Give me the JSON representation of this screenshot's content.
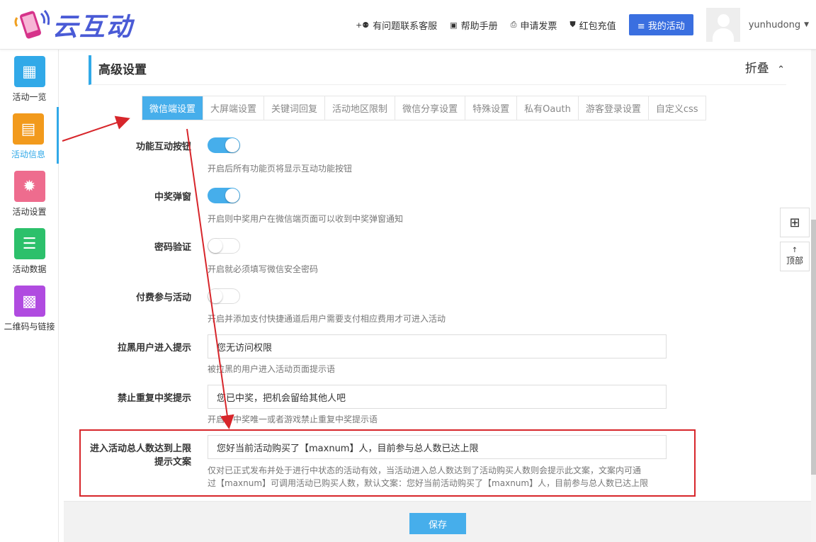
{
  "app": {
    "logo_text": "云互动"
  },
  "header": {
    "links": [
      {
        "icon": "user-plus-icon",
        "label": "有问题联系客服"
      },
      {
        "icon": "book-icon",
        "label": "帮助手册"
      },
      {
        "icon": "printer-icon",
        "label": "申请发票"
      },
      {
        "icon": "shield-icon",
        "label": "红包充值"
      }
    ],
    "my_activity": "≡ 我的活动",
    "username": "yunhudong"
  },
  "sidebar": {
    "items": [
      {
        "label": "活动一览",
        "icon": "grid-icon",
        "color": "#31a9e8"
      },
      {
        "label": "活动信息",
        "icon": "document-icon",
        "color": "#f29a1c"
      },
      {
        "label": "活动设置",
        "icon": "gear-icon",
        "color": "#ee6c8e"
      },
      {
        "label": "活动数据",
        "icon": "database-icon",
        "color": "#2cc06b"
      },
      {
        "label": "二维码与链接",
        "icon": "qrcode-icon",
        "color": "#b04be0"
      }
    ]
  },
  "section": {
    "title": "高级设置",
    "collapse_label": "折叠"
  },
  "tabs": [
    "微信端设置",
    "大屏端设置",
    "关键词回复",
    "活动地区限制",
    "微信分享设置",
    "特殊设置",
    "私有Oauth",
    "游客登录设置",
    "自定义css"
  ],
  "settings": {
    "func_button": {
      "label": "功能互动按钮",
      "enabled": true,
      "help": "开启后所有功能页将显示互动功能按钮"
    },
    "prize_popup": {
      "label": "中奖弹窗",
      "enabled": true,
      "help": "开启则中奖用户在微信端页面可以收到中奖弹窗通知"
    },
    "password": {
      "label": "密码验证",
      "enabled": false,
      "help": "开启就必须填写微信安全密码"
    },
    "paid": {
      "label": "付费参与活动",
      "enabled": false,
      "help": "开启并添加支付快捷通道后用户需要支付相应费用才可进入活动"
    },
    "blacklist": {
      "label": "拉黑用户进入提示",
      "value": "您无访问权限",
      "help": "被拉黑的用户进入活动页面提示语"
    },
    "repeat_prize": {
      "label": "禁止重复中奖提示",
      "value": "您已中奖，把机会留给其他人吧",
      "help": "开启了中奖唯一或者游戏禁止重复中奖提示语"
    },
    "max_people": {
      "label_line1": "进入活动总人数达到上限",
      "label_line2": "提示文案",
      "value": "您好当前活动购买了【maxnum】人，目前参与总人数已达上限",
      "help_line1": "仅对已正式发布并处于进行中状态的活动有效，当活动进入总人数达到了活动购买人数则会提示此文案，文案内可通",
      "help_line2": "过【maxnum】可调用活动已购买人数，默认文案：您好当前活动购买了【maxnum】人，目前参与总人数已达上限"
    }
  },
  "footer": {
    "save_label": "保存"
  },
  "float_tools": {
    "top_label": "顶部"
  },
  "colors": {
    "accent": "#46aeeb",
    "annotation": "#d7262b"
  }
}
